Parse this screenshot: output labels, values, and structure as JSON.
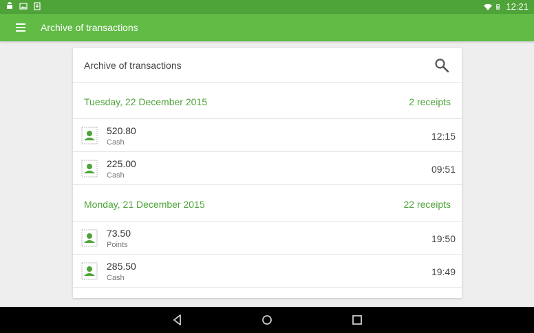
{
  "status_bar": {
    "time": "12:21",
    "icons_left": [
      "android-icon",
      "image-icon",
      "download-icon"
    ],
    "icons_right": [
      "wifi-icon",
      "battery-icon"
    ]
  },
  "app_bar": {
    "title": "Archive of transactions"
  },
  "card": {
    "title": "Archive of transactions"
  },
  "groups": [
    {
      "date": "Tuesday, 22 December 2015",
      "count": "2 receipts",
      "rows": [
        {
          "amount": "520.80",
          "method": "Cash",
          "time": "12:15"
        },
        {
          "amount": "225.00",
          "method": "Cash",
          "time": "09:51"
        }
      ]
    },
    {
      "date": "Monday, 21 December 2015",
      "count": "22 receipts",
      "rows": [
        {
          "amount": "73.50",
          "method": "Points",
          "time": "19:50"
        },
        {
          "amount": "285.50",
          "method": "Cash",
          "time": "19:49"
        }
      ]
    }
  ],
  "colors": {
    "accent": "#61bb45",
    "status_bar": "#4ea339",
    "group_text": "#4ea339"
  }
}
